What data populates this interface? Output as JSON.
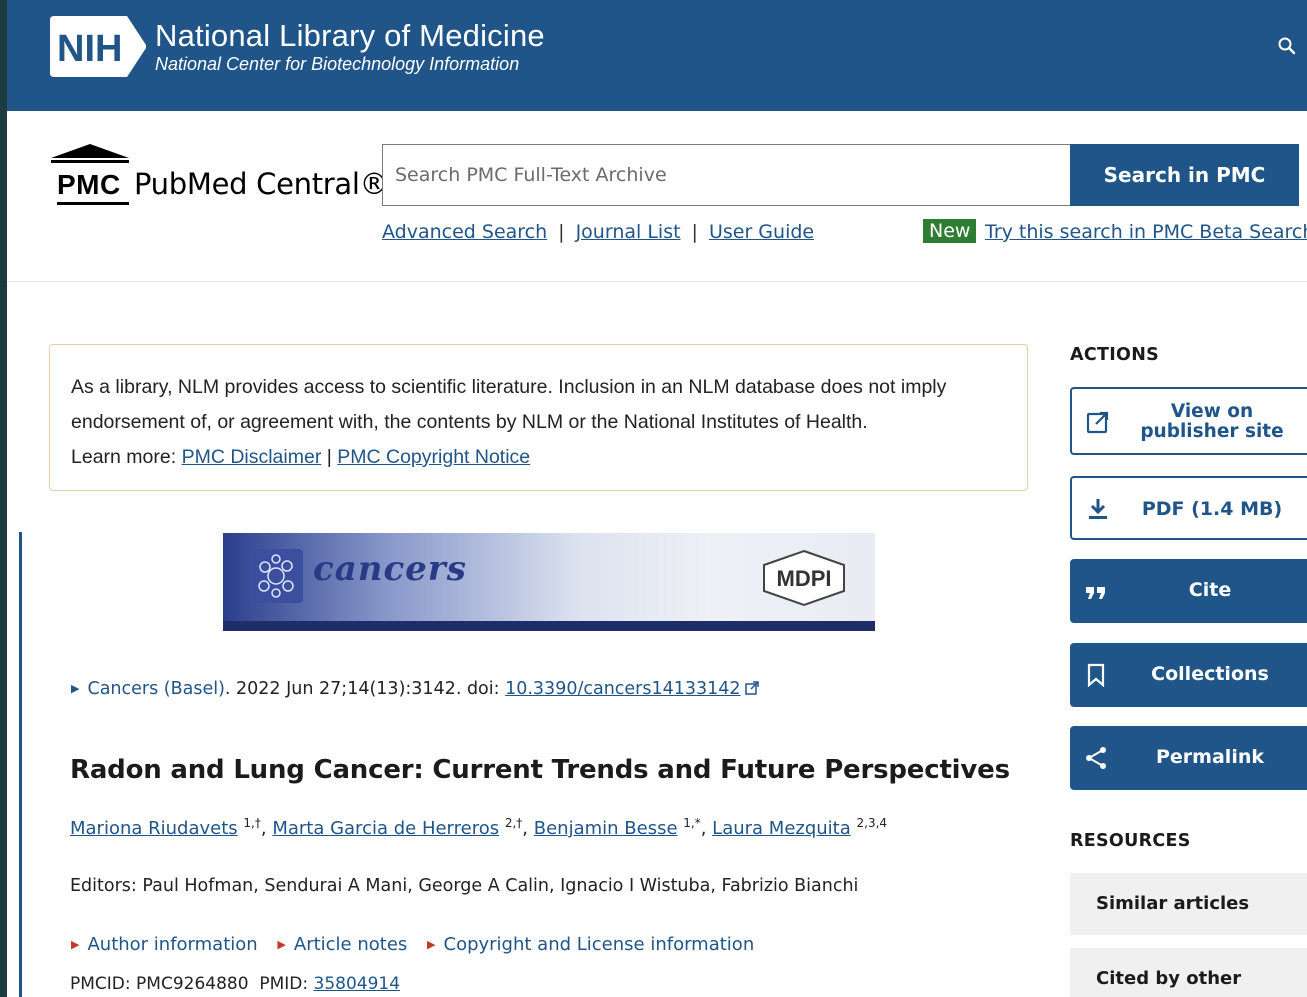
{
  "nih": {
    "logo_text": "NIH",
    "title": "National Library of Medicine",
    "subtitle": "National Center for Biotechnology Information"
  },
  "pmc": {
    "logo_text": "PMC",
    "name": "PubMed Central®",
    "search_placeholder": "Search PMC Full-Text Archive",
    "search_button": "Search in PMC",
    "links": [
      "Advanced Search",
      "Journal List",
      "User Guide"
    ],
    "new_badge": "New",
    "beta_link": "Try this search in PMC Beta Search"
  },
  "disclaimer": {
    "text": "As a library, NLM provides access to scientific literature. Inclusion in an NLM database does not imply endorsement of, or agreement with, the contents by NLM or the National Institutes of Health.",
    "learn_more": "Learn more:",
    "link1": "PMC Disclaimer",
    "separator": "|",
    "link2": "PMC Copyright Notice"
  },
  "banner": {
    "journal_name": "cancers",
    "publisher": "MDPI"
  },
  "citation": {
    "journal": "Cancers (Basel)",
    "details": ". 2022 Jun 27;14(13):3142. doi: ",
    "doi": "10.3390/cancers14133142"
  },
  "article": {
    "title": "Radon and Lung Cancer: Current Trends and Future Perspectives",
    "authors": [
      {
        "name": "Mariona Riudavets",
        "sup": "1,†"
      },
      {
        "name": "Marta Garcia de Herreros",
        "sup": "2,†"
      },
      {
        "name": "Benjamin Besse",
        "sup": "1,*"
      },
      {
        "name": "Laura Mezquita",
        "sup": "2,3,4"
      }
    ],
    "editors": "Editors: Paul Hofman, Sendurai A Mani, George A Calin, Ignacio I Wistuba, Fabrizio Bianchi",
    "info_links": [
      "Author information",
      "Article notes",
      "Copyright and License information"
    ],
    "pmcid_label": "PMCID: PMC9264880",
    "pmid_label": "PMID:",
    "pmid": "35804914"
  },
  "actions": {
    "heading": "ACTIONS",
    "items": [
      {
        "label_line1": "View on",
        "label_line2": "publisher site",
        "icon": "external-link-icon"
      },
      {
        "label": "PDF (1.4 MB)",
        "icon": "download-icon"
      },
      {
        "label": "Cite",
        "icon": "quote-icon"
      },
      {
        "label": "Collections",
        "icon": "bookmark-icon"
      },
      {
        "label": "Permalink",
        "icon": "share-icon"
      }
    ]
  },
  "resources": {
    "heading": "RESOURCES",
    "items": [
      "Similar articles",
      "Cited by other articles"
    ]
  },
  "colors": {
    "nih_blue": "#20558a",
    "new_badge_green": "#2e7d32",
    "page_background": "#1c3b3f"
  }
}
